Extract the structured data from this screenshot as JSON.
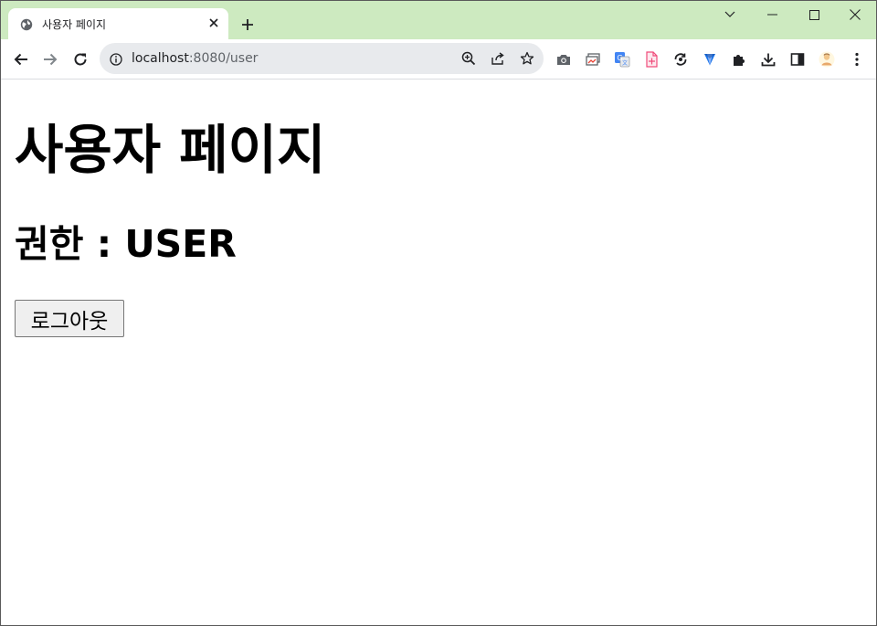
{
  "browser": {
    "tab": {
      "title": "사용자 페이지"
    },
    "address_bar": {
      "host": "localhost",
      "rest": ":8080/user"
    },
    "toolbar_icons": [
      "back-arrow-icon",
      "forward-arrow-icon",
      "reload-icon",
      "site-info-icon",
      "zoom-icon",
      "share-icon",
      "bookmark-star-icon"
    ],
    "extension_icons": [
      "camera-icon",
      "window-capture-icon",
      "google-translate-icon",
      "pdf-icon",
      "sync-icon",
      "arrow-down-gem-icon",
      "extensions-puzzle-icon",
      "download-icon",
      "side-panel-icon",
      "profile-avatar-icon",
      "more-menu-icon"
    ],
    "colors": {
      "tabstrip": "#cdeac0",
      "omnibox": "#e8eaed"
    }
  },
  "page": {
    "title": "사용자 페이지",
    "role_heading": "권한 : USER",
    "logout_button": "로그아웃"
  }
}
